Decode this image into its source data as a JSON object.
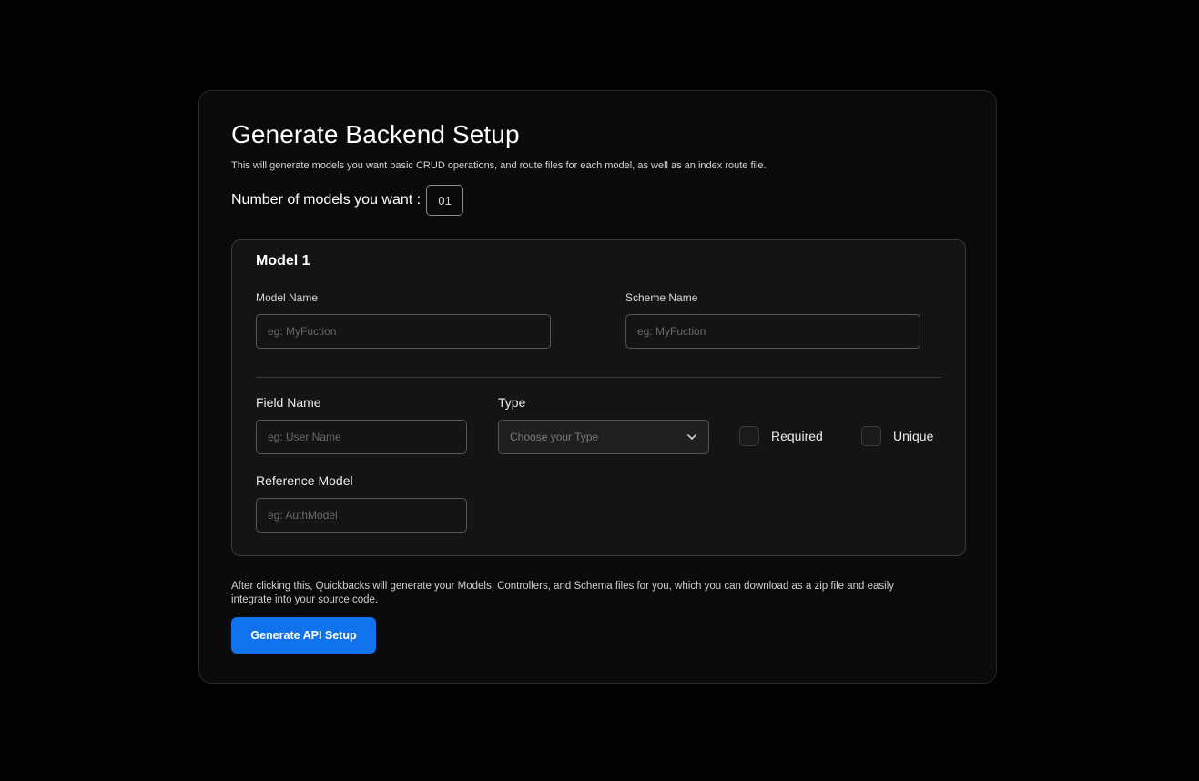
{
  "page": {
    "title": "Generate Backend Setup",
    "subtitle": "This will generate models you want basic CRUD operations, and route files for each model, as well as an index route file."
  },
  "models_count": {
    "label": "Number of models you want :",
    "value": "01"
  },
  "model": {
    "title": "Model 1",
    "model_name": {
      "label": "Model Name",
      "placeholder": "eg: MyFuction",
      "value": ""
    },
    "scheme_name": {
      "label": "Scheme Name",
      "placeholder": "eg: MyFuction",
      "value": ""
    },
    "field_name": {
      "label": "Field Name",
      "placeholder": "eg: User Name",
      "value": ""
    },
    "type": {
      "label": "Type",
      "placeholder": "Choose your Type"
    },
    "required": {
      "label": "Required",
      "checked": false
    },
    "unique": {
      "label": "Unique",
      "checked": false
    },
    "reference_model": {
      "label": "Reference Model",
      "placeholder": "eg: AuthModel",
      "value": ""
    }
  },
  "footer": {
    "note": "After clicking this, Quickbacks will generate your Models, Controllers, and Schema files for you, which you can download as a zip file and easily integrate into your source code.",
    "button_label": "Generate API Setup"
  },
  "colors": {
    "background": "#000000",
    "card": "#0a0a0a",
    "panel": "#141414",
    "accent": "#1172ee"
  },
  "icons": {
    "type_dropdown": "chevron-down-icon"
  }
}
